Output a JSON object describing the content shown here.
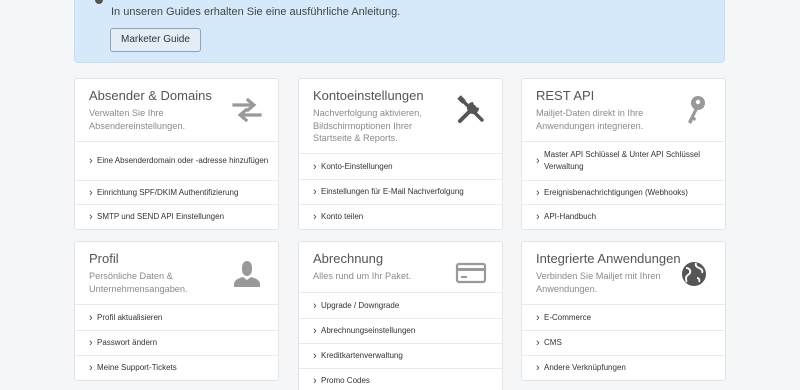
{
  "banner": {
    "text": "In unseren Guides erhalten Sie eine ausführliche Anleitung.",
    "button_label": "Marketer Guide"
  },
  "cards": [
    {
      "title": "Absender & Domains",
      "description": "Verwalten Sie Ihre Absendereinstellungen.",
      "icon": "arrows-swap-icon",
      "links": [
        "Eine Absenderdomain oder -adresse hinzufügen",
        "Einrichtung SPF/DKIM Authentifizierung",
        "SMTP und SEND API Einstellungen"
      ]
    },
    {
      "title": "Kontoeinstellungen",
      "description": "Nachverfolgung aktivieren, Bildschirmoptionen Ihrer Startseite & Reports.",
      "icon": "tools-icon",
      "links": [
        "Konto-Einstellungen",
        "Einstellungen für E-Mail Nachverfolgung",
        "Konto teilen"
      ]
    },
    {
      "title": "REST API",
      "description": "Mailjet-Daten direkt in Ihre Anwendungen integrieren.",
      "icon": "key-icon",
      "links": [
        "Master API Schlüssel & Unter API Schlüssel Verwaltung",
        "Ereignisbenachrichtigungen (Webhooks)",
        "API-Handbuch"
      ]
    },
    {
      "title": "Profil",
      "description": "Persönliche Daten & Unternehmensangaben.",
      "icon": "user-icon",
      "links": [
        "Profil aktualisieren",
        "Passwort ändern",
        "Meine Support-Tickets"
      ]
    },
    {
      "title": "Abrechnung",
      "description": "Alles rund um Ihr Paket.",
      "icon": "credit-card-icon",
      "links": [
        "Upgrade / Downgrade",
        "Abrechnungseinstellungen",
        "Kreditkartenverwaltung",
        "Promo Codes"
      ]
    },
    {
      "title": "Integrierte Anwendungen",
      "description": "Verbinden Sie Mailjet mit Ihren Anwendungen.",
      "icon": "globe-icon",
      "links": [
        "E-Commerce",
        "CMS",
        "Andere Verknüpfungen"
      ]
    }
  ]
}
